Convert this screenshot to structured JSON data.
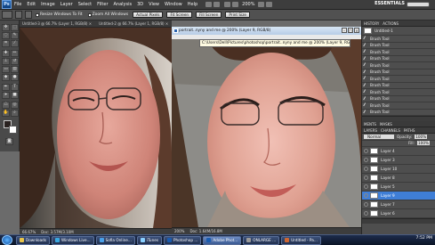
{
  "menubar": {
    "logo": "Ps",
    "items": [
      "File",
      "Edit",
      "Image",
      "Layer",
      "Select",
      "Filter",
      "Analysis",
      "3D",
      "View",
      "Window",
      "Help"
    ],
    "zoom": "200%",
    "workspace": "ESSENTIALS"
  },
  "options": {
    "resize_windows": "Resize Windows To Fit",
    "zoom_all": "Zoom All Windows",
    "actual_pixels": "Actual Pixels",
    "fit_screen": "Fit Screen",
    "fill_screen": "Fill Screen",
    "print_size": "Print Size"
  },
  "doc1": {
    "tab": "Untitled-3 @ 66.7% (Layer 1, RGB/8) ×",
    "tab2": "Untitled-2 @ 66.7% (Layer 1, RGB/8) ×",
    "zoom": "66.67%",
    "doc_size": "Doc: 3.57M/3.10M"
  },
  "doc2": {
    "title": "portrait..nyny and me @ 200% (Layer 9, RGB/8)",
    "path": "C:\\Users\\Dell\\Pictures\\photoshop\\portrait..nyny and me @ 200% (Layer 9, RGB/8)",
    "zoom": "200%",
    "doc_size": "Doc: 1.64M/16.8M"
  },
  "history": {
    "header": "HISTORY",
    "actions": "ACTIONS",
    "snapshot": "Untitled-1",
    "items": [
      "Brush Tool",
      "Brush Tool",
      "Brush Tool",
      "Brush Tool",
      "Brush Tool",
      "Brush Tool",
      "Brush Tool",
      "Brush Tool",
      "Brush Tool",
      "Brush Tool",
      "Brush Tool",
      "Brush Tool"
    ]
  },
  "adjust": {
    "tabs": [
      "MENTS",
      "MASKS"
    ],
    "tabs2": [
      "LAYERS",
      "CHANNELS",
      "PATHS"
    ],
    "mode": "Normal",
    "opacity_label": "Opacity:",
    "opacity": "100%",
    "fill_label": "Fill:",
    "fill": "100%"
  },
  "layers": [
    {
      "name": "Layer 4",
      "selected": false
    },
    {
      "name": "Layer 3",
      "selected": false
    },
    {
      "name": "Layer 10",
      "selected": false
    },
    {
      "name": "Layer 8",
      "selected": false
    },
    {
      "name": "Layer 5",
      "selected": false
    },
    {
      "name": "Layer 9",
      "selected": true
    },
    {
      "name": "Layer 7",
      "selected": false
    },
    {
      "name": "Layer 6",
      "selected": false
    }
  ],
  "taskbar": {
    "items": [
      {
        "label": "Downloads",
        "color": "#e8c44a"
      },
      {
        "label": "Windows Live...",
        "color": "#3aa8e0"
      },
      {
        "label": "Sofia Online...",
        "color": "#4aa0e8"
      },
      {
        "label": "iTunes",
        "color": "#8ad0ff"
      },
      {
        "label": "Photoshop ...",
        "color": "#1a5cb0"
      },
      {
        "label": "Adobe Phot...",
        "color": "#1a5cb0"
      },
      {
        "label": "ONLARGE ...",
        "color": "#999999"
      },
      {
        "label": "Untitled - Pa...",
        "color": "#cc6633"
      }
    ],
    "active_index": 5,
    "clock": "7:52 PM"
  }
}
